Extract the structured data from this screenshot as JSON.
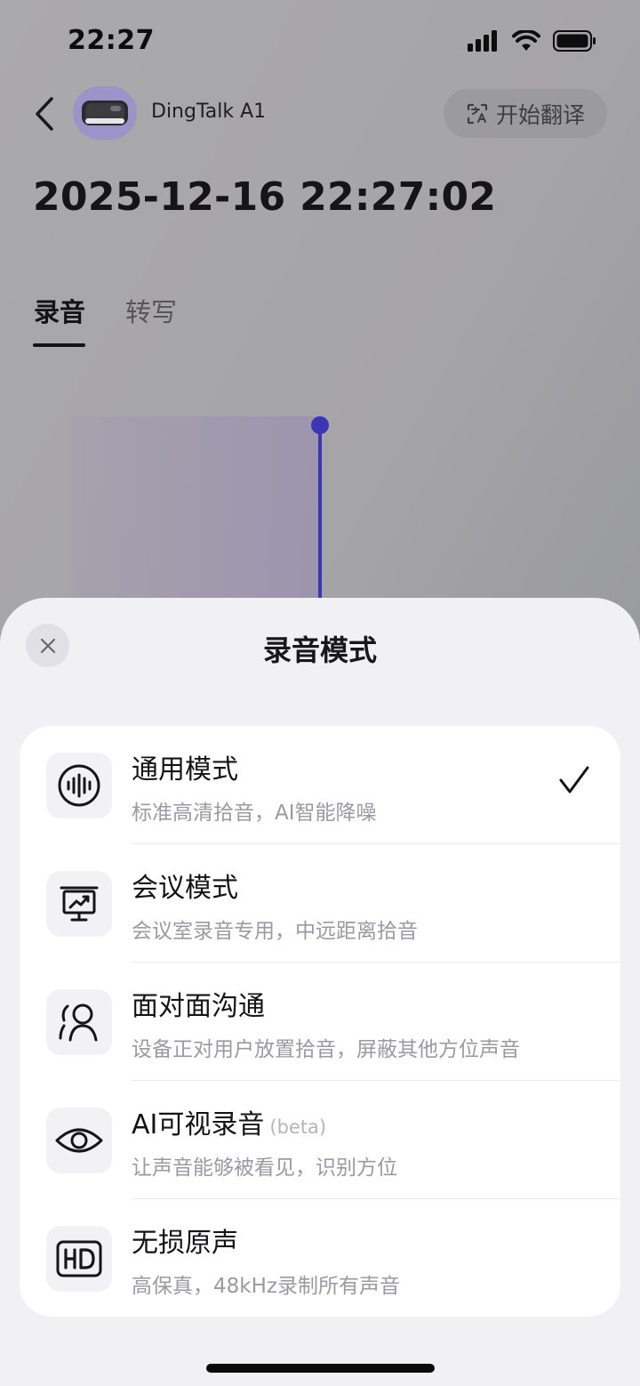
{
  "status_bar": {
    "time": "22:27",
    "icons": [
      "signal-icon",
      "wifi-icon",
      "battery-icon"
    ]
  },
  "header": {
    "device_name": "DingTalk A1",
    "translate_label": "开始翻译"
  },
  "recording": {
    "datetime": "2025-12-16 22:27:02",
    "tabs": [
      {
        "label": "录音",
        "active": true
      },
      {
        "label": "转写",
        "active": false
      }
    ]
  },
  "sheet": {
    "title": "录音模式",
    "modes": [
      {
        "icon": "waveform-icon",
        "title": "通用模式",
        "beta": "",
        "desc": "标准高清拾音，AI智能降噪",
        "selected": true
      },
      {
        "icon": "presentation-icon",
        "title": "会议模式",
        "beta": "",
        "desc": "会议室录音专用，中远距离拾音",
        "selected": false
      },
      {
        "icon": "person-icon",
        "title": "面对面沟通",
        "beta": "",
        "desc": "设备正对用户放置拾音，屏蔽其他方位声音",
        "selected": false
      },
      {
        "icon": "eye-icon",
        "title": "AI可视录音",
        "beta": "(beta)",
        "desc": "让声音能够被看见，识别方位",
        "selected": false
      },
      {
        "icon": "hd-icon",
        "title": "无损原声",
        "beta": "",
        "desc": "高保真，48kHz录制所有声音",
        "selected": false
      }
    ]
  },
  "colors": {
    "accent": "#3b36b5",
    "sheet_bg": "#f1f1f4",
    "card_bg": "#ffffff"
  }
}
